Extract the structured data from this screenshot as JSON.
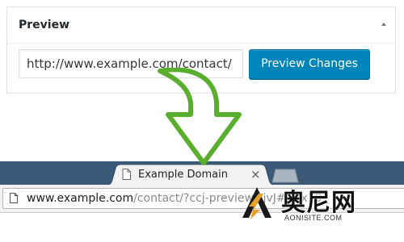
{
  "metabox": {
    "title": "Preview",
    "toggle_icon": "triangle-up-icon",
    "url_value": "http://www.example.com/contact/",
    "preview_button_label": "Preview Changes"
  },
  "arrow": {
    "icon": "curved-down-arrow-icon",
    "color": "#5aae2e"
  },
  "browser": {
    "tab_title": "Example Domain",
    "tab_close_label": "×",
    "url_host": "www.example.com",
    "url_rest": "/contact/?ccj-preview=jvJ#Hox10"
  },
  "watermark": {
    "name_cn": "奥尼网",
    "site": "AONISITE.COM",
    "logo_colors": [
      "#e8a02c",
      "#1a1a1a"
    ]
  },
  "colors": {
    "accent": "#0085ba",
    "tabstrip": "#3b5a78",
    "arrow": "#5aae2e"
  }
}
